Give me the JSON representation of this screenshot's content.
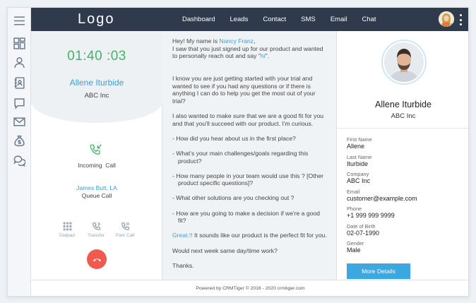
{
  "header": {
    "logo": "Logo",
    "nav": [
      "Dashboard",
      "Leads",
      "Contact",
      "SMS",
      "Email",
      "Chat"
    ]
  },
  "rail": {
    "icons": [
      "menu-icon",
      "dashboard-icon",
      "user-icon",
      "contacts-book-icon",
      "chat-icon",
      "mail-icon",
      "money-bag-icon",
      "support-chat-icon"
    ]
  },
  "call": {
    "timer": "01:40 :03",
    "caller_name": "Allene Iturbide",
    "caller_company": "ABC Inc",
    "status_label": "Incoming  Call",
    "queue_agent": "James Butt, LA",
    "queue_label": "Queue Call",
    "tools": [
      "Dialpad",
      "Transfer",
      "Park Call"
    ]
  },
  "script": {
    "greeting_pre": "Hey! My name is ",
    "greeting_name": "Nancy Franz",
    "greeting_post": ",",
    "intro_pre": "I saw that you just signed up for our product and wanted to personally reach out and say \"",
    "intro_hi": "hi",
    "intro_post": "\".",
    "p2": "I know you are just getting started with your trial and wanted to see if you had any questions or if there is anything I can do to help you get the most out of your trial?",
    "p3": "I also wanted to make sure that we are a good fit for you and that you'll succeed with our product. I'm curious.",
    "questions": [
      "- How did you hear about us in the first place?",
      "- What's your main challenges/goals regarding this product?",
      "- How many people in your team would use this ? [Other product specific questions]?",
      "- What other solutions are you checking out ?",
      "- How are you going to make a decision if we're a good fit?"
    ],
    "great": "Great.!!",
    "great_post": " It sounds like our product is the perfect fit for you.",
    "p_next": "Would next week same day/time work?",
    "p_thanks": "Thanks."
  },
  "details": {
    "name": "Allene Iturbide",
    "company": "ABC Inc",
    "fields": [
      {
        "label": "First Name",
        "value": "Allene"
      },
      {
        "label": "Last Name",
        "value": "Iturbide"
      },
      {
        "label": "Company",
        "value": "ABC Inc"
      },
      {
        "label": "Email",
        "value": "customer@example.com"
      },
      {
        "label": "Phone",
        "value": "+1 999 999 9999"
      },
      {
        "label": "Date of Birth",
        "value": "02-07-1990"
      },
      {
        "label": "Gender",
        "value": "Male"
      }
    ],
    "more_button": "More Details"
  },
  "footer": {
    "text": "Powered by CRMTiger © 2016 - 2020  crmtiger.com"
  },
  "colors": {
    "header_bg": "#2f3b4c",
    "timer_green": "#45b36b",
    "accent_blue": "#3aa0d8",
    "hangup_red": "#f05a4f",
    "button_blue": "#3ca7e0"
  }
}
